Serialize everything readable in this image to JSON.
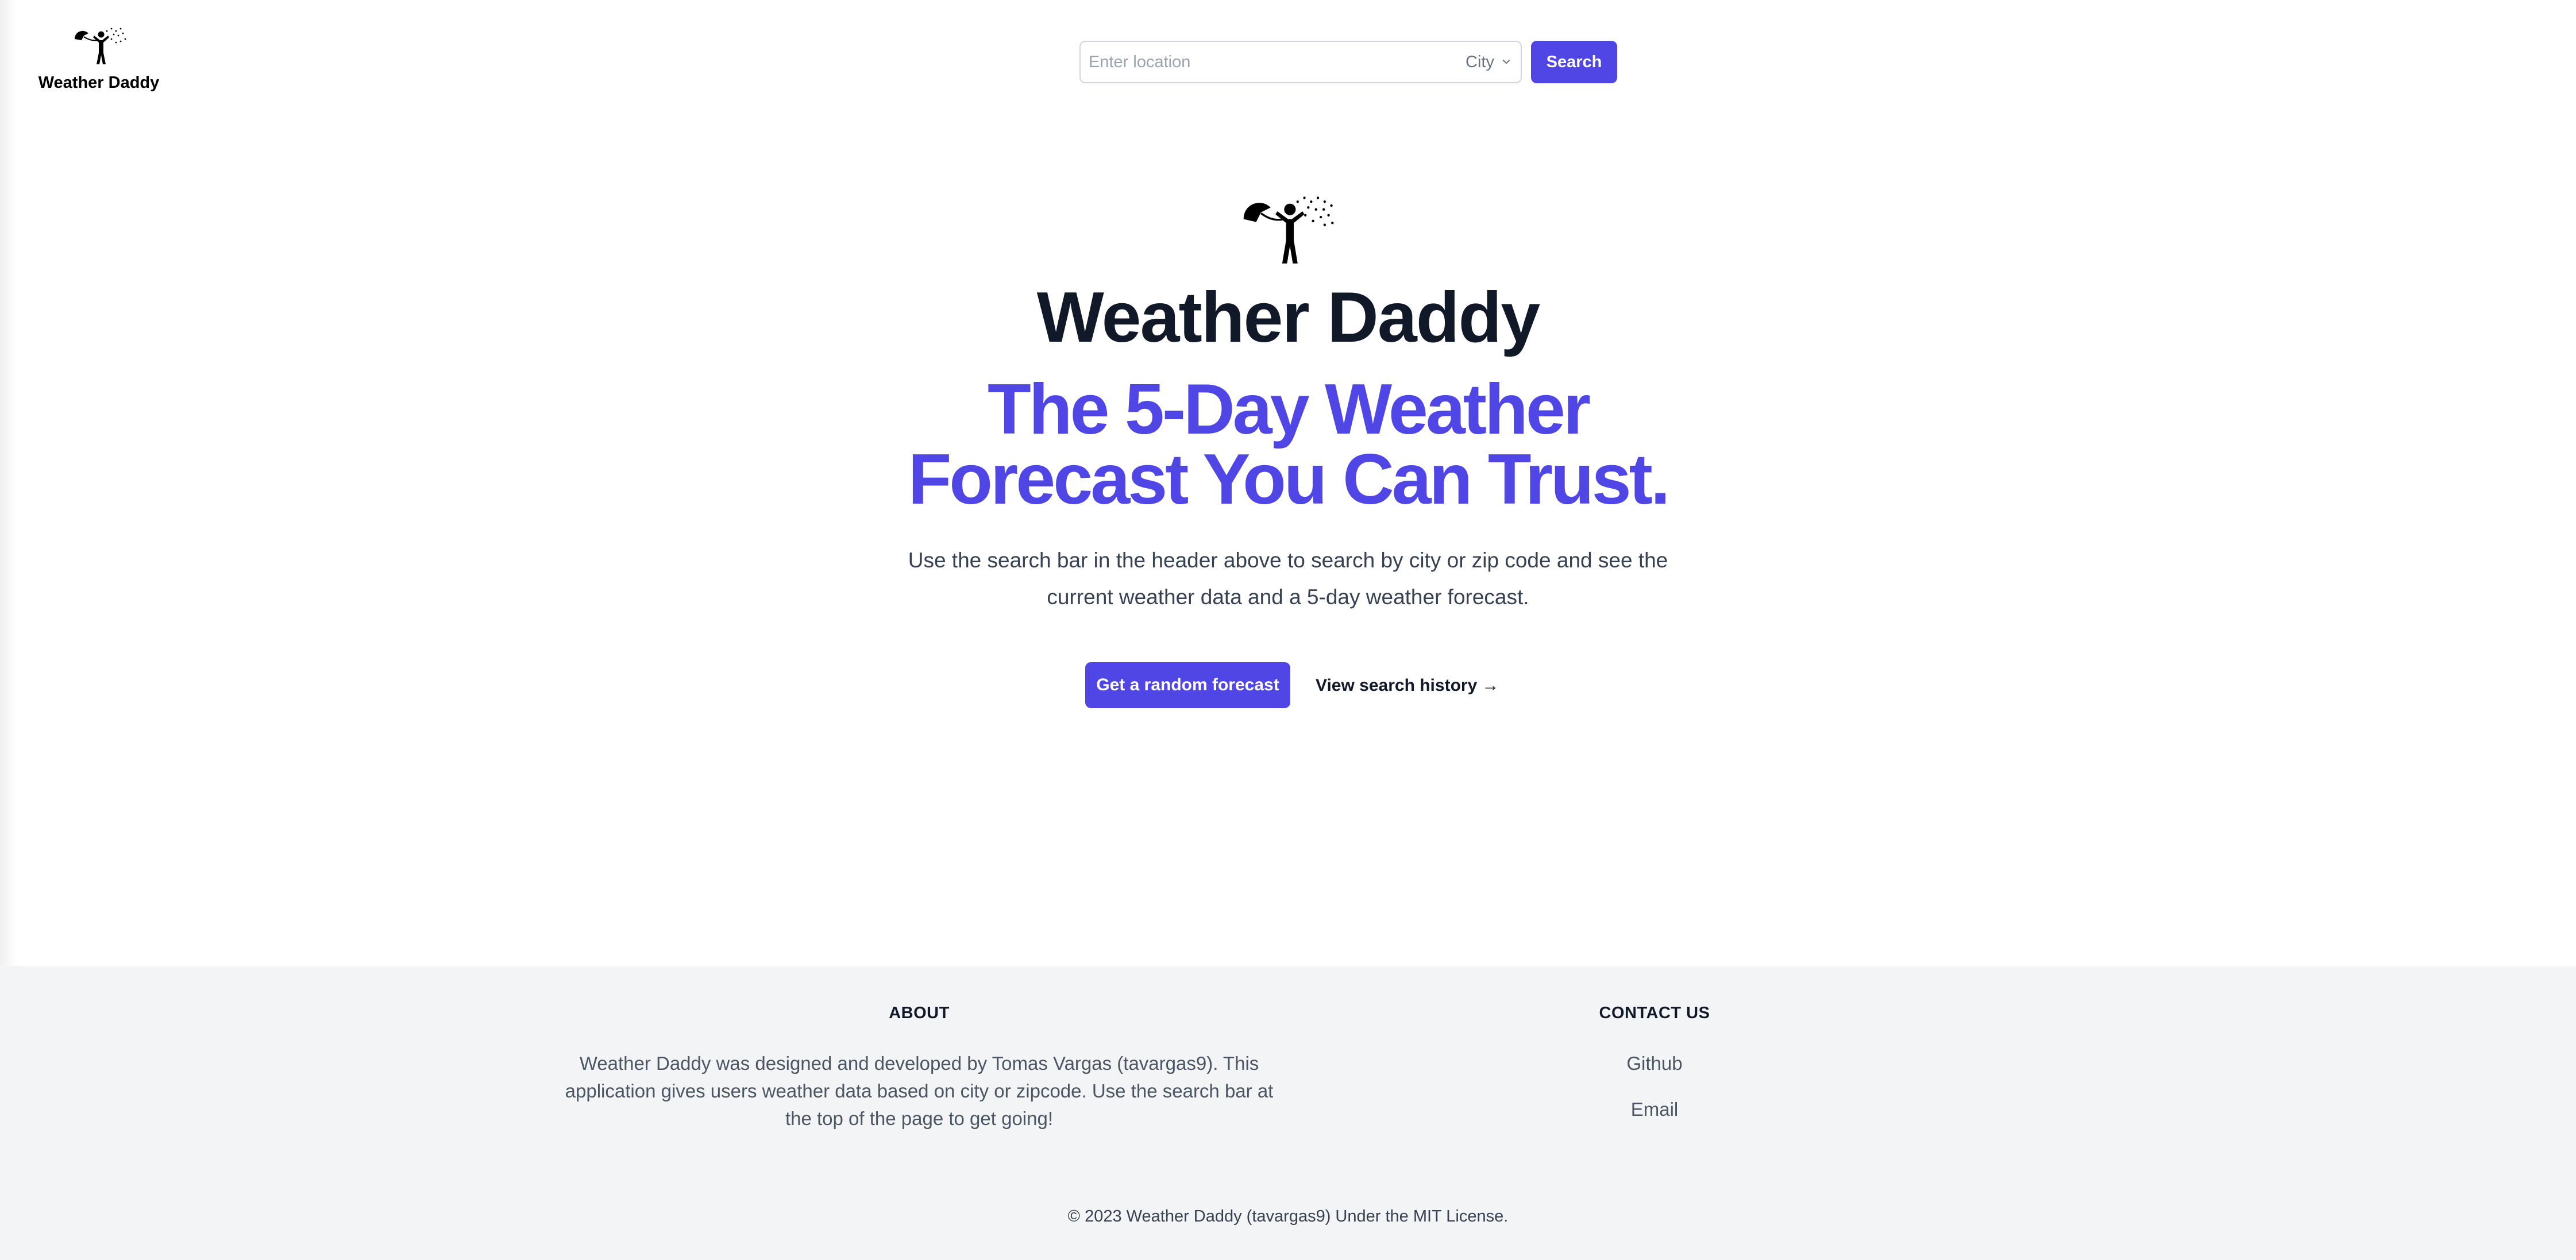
{
  "header": {
    "brand_name": "Weather Daddy",
    "search": {
      "placeholder": "Enter location",
      "value": "",
      "type_selected": "City",
      "button_label": "Search"
    }
  },
  "hero": {
    "title": "Weather Daddy",
    "tagline": "The 5-Day Weather Forecast You Can Trust.",
    "intro": "Use the search bar in the header above to search by city or zip code and see the current weather data and a 5-day weather forecast.",
    "random_button": "Get a random forecast",
    "history_link": "View search history",
    "history_arrow": "→"
  },
  "footer": {
    "about_heading": "ABOUT",
    "about_text": "Weather Daddy was designed and developed by Tomas Vargas (tavargas9). This application gives users weather data based on city or zipcode. Use the search bar at the top of the page to get going!",
    "contact_heading": "CONTACT US",
    "contact_links": [
      "Github",
      "Email"
    ],
    "copyright": "© 2023 Weather Daddy (tavargas9) Under the MIT License."
  },
  "colors": {
    "accent": "#4f46e5",
    "footer_bg": "#f3f4f6",
    "title": "#111827"
  },
  "icons": {
    "logo": "umbrella-person-rain-icon",
    "select_caret": "chevron-down-icon",
    "history_arrow": "arrow-right-icon"
  }
}
